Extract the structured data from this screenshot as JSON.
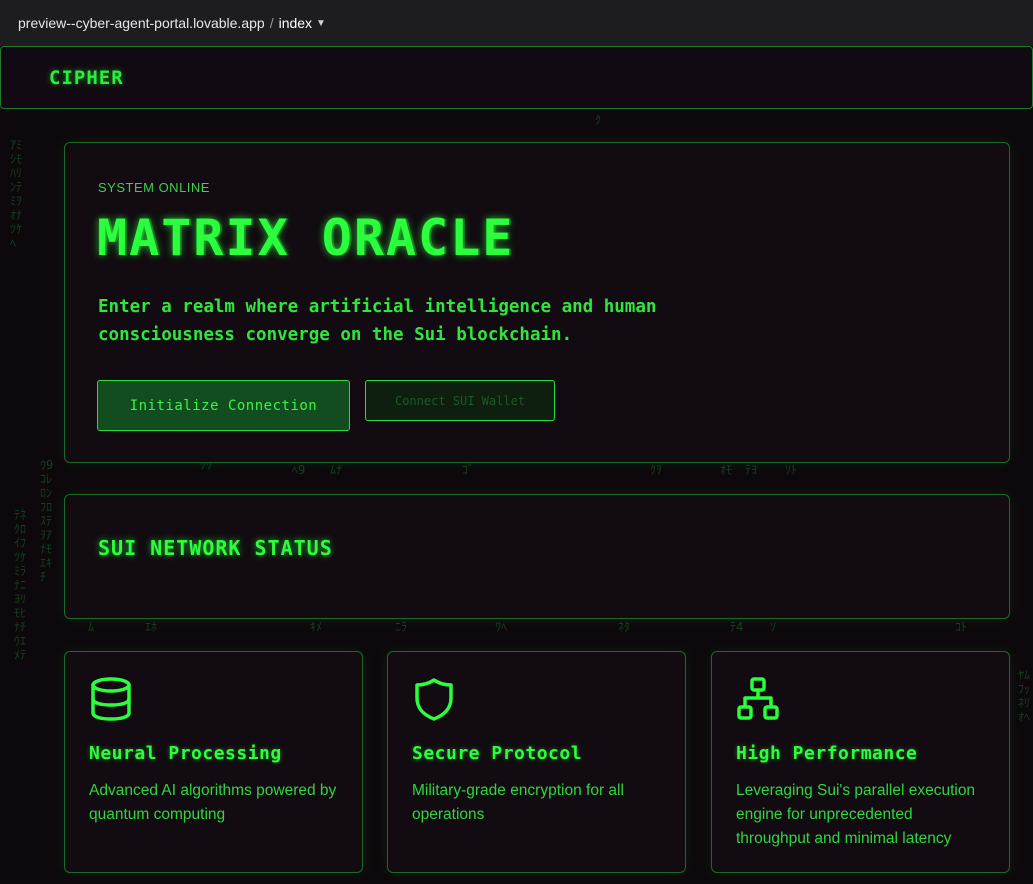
{
  "browser": {
    "host": "preview--cyber-agent-portal.lovable.app",
    "separator": "/",
    "page": "index"
  },
  "navbar": {
    "brand": "CIPHER"
  },
  "hero": {
    "kicker": "SYSTEM ONLINE",
    "title": "MATRIX ORACLE",
    "description": "Enter a realm where artificial intelligence and human consciousness converge on the Sui blockchain.",
    "primary_button": "Initialize Connection",
    "secondary_button": "Connect SUI Wallet"
  },
  "status": {
    "title": "SUI NETWORK STATUS"
  },
  "features": [
    {
      "icon": "database-icon",
      "title": "Neural Processing",
      "description": "Advanced AI algorithms powered by quantum computing"
    },
    {
      "icon": "shield-icon",
      "title": "Secure Protocol",
      "description": "Military-grade encryption for all operations"
    },
    {
      "icon": "network-icon",
      "title": "High Performance",
      "description": "Leveraging Sui's parallel execution engine for unprecedented throughput and minimal latency"
    }
  ],
  "colors": {
    "accent": "#2bff3d",
    "background": "#0d080c",
    "panel": "#120b11",
    "border": "#1d6a28"
  }
}
